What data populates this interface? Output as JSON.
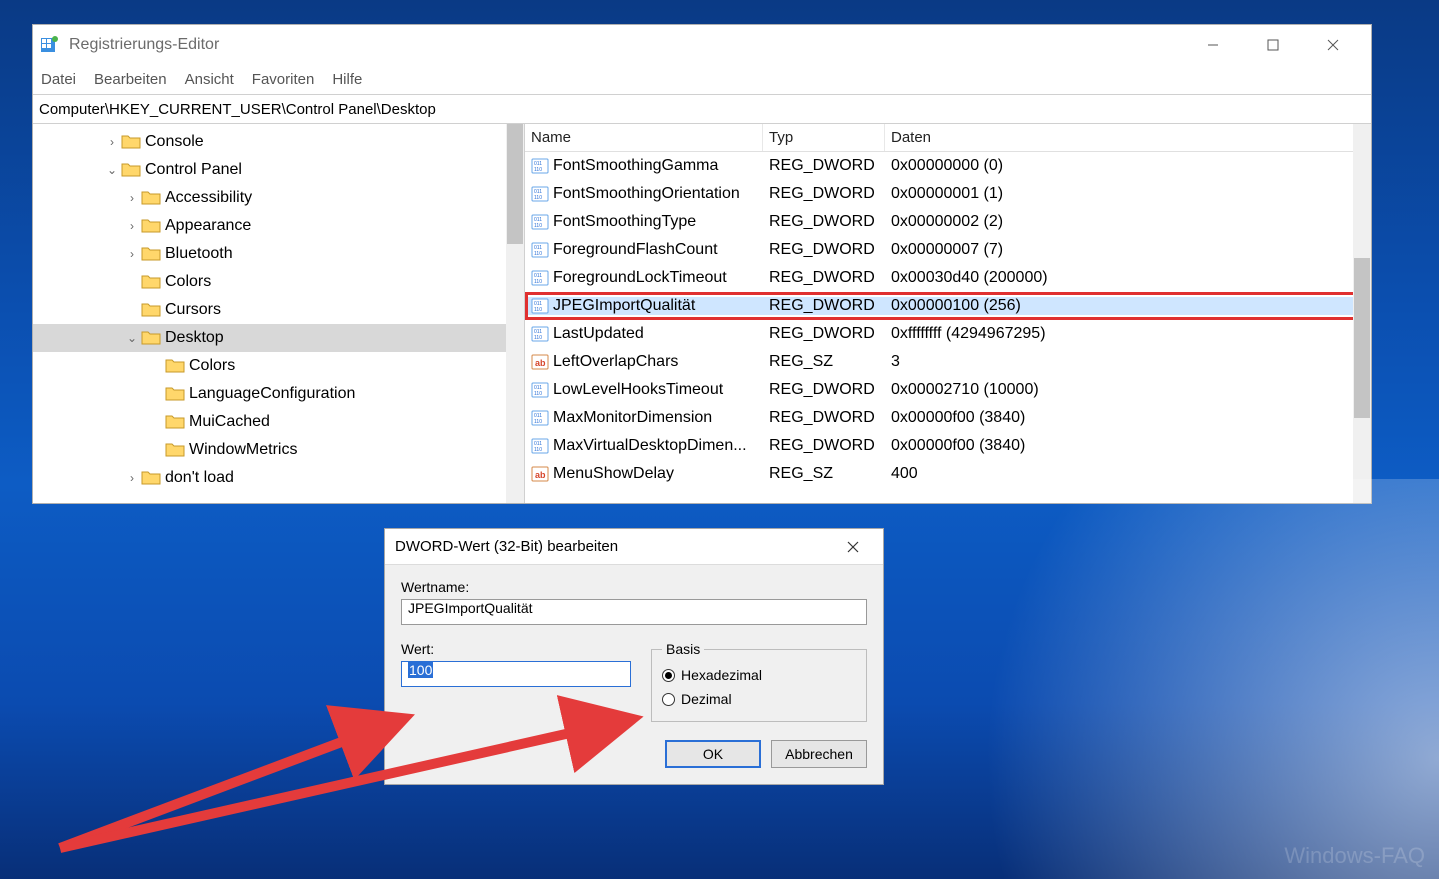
{
  "window": {
    "title": "Registrierungs-Editor",
    "menu": [
      "Datei",
      "Bearbeiten",
      "Ansicht",
      "Favoriten",
      "Hilfe"
    ],
    "address": "Computer\\HKEY_CURRENT_USER\\Control Panel\\Desktop"
  },
  "tree": [
    {
      "level": 1,
      "twisty": ">",
      "label": "Console"
    },
    {
      "level": 1,
      "twisty": "v",
      "label": "Control Panel"
    },
    {
      "level": 2,
      "twisty": ">",
      "label": "Accessibility"
    },
    {
      "level": 2,
      "twisty": ">",
      "label": "Appearance"
    },
    {
      "level": 2,
      "twisty": ">",
      "label": "Bluetooth"
    },
    {
      "level": 2,
      "twisty": "",
      "label": "Colors"
    },
    {
      "level": 2,
      "twisty": "",
      "label": "Cursors"
    },
    {
      "level": 2,
      "twisty": "v",
      "label": "Desktop",
      "selected": true
    },
    {
      "level": 3,
      "twisty": "",
      "label": "Colors"
    },
    {
      "level": 3,
      "twisty": "",
      "label": "LanguageConfiguration"
    },
    {
      "level": 3,
      "twisty": "",
      "label": "MuiCached"
    },
    {
      "level": 3,
      "twisty": "",
      "label": "WindowMetrics"
    },
    {
      "level": 2,
      "twisty": ">",
      "label": "don't load"
    }
  ],
  "columns": {
    "name": "Name",
    "type": "Typ",
    "data": "Daten"
  },
  "values": [
    {
      "icon": "dword",
      "name": "FontSmoothingGamma",
      "type": "REG_DWORD",
      "data": "0x00000000 (0)"
    },
    {
      "icon": "dword",
      "name": "FontSmoothingOrientation",
      "type": "REG_DWORD",
      "data": "0x00000001 (1)"
    },
    {
      "icon": "dword",
      "name": "FontSmoothingType",
      "type": "REG_DWORD",
      "data": "0x00000002 (2)"
    },
    {
      "icon": "dword",
      "name": "ForegroundFlashCount",
      "type": "REG_DWORD",
      "data": "0x00000007 (7)"
    },
    {
      "icon": "dword",
      "name": "ForegroundLockTimeout",
      "type": "REG_DWORD",
      "data": "0x00030d40 (200000)"
    },
    {
      "icon": "dword",
      "name": "JPEGImportQualität",
      "type": "REG_DWORD",
      "data": "0x00000100 (256)",
      "highlight": true
    },
    {
      "icon": "dword",
      "name": "LastUpdated",
      "type": "REG_DWORD",
      "data": "0xffffffff (4294967295)"
    },
    {
      "icon": "sz",
      "name": "LeftOverlapChars",
      "type": "REG_SZ",
      "data": "3"
    },
    {
      "icon": "dword",
      "name": "LowLevelHooksTimeout",
      "type": "REG_DWORD",
      "data": "0x00002710 (10000)"
    },
    {
      "icon": "dword",
      "name": "MaxMonitorDimension",
      "type": "REG_DWORD",
      "data": "0x00000f00 (3840)"
    },
    {
      "icon": "dword",
      "name": "MaxVirtualDesktopDimen...",
      "type": "REG_DWORD",
      "data": "0x00000f00 (3840)"
    },
    {
      "icon": "sz",
      "name": "MenuShowDelay",
      "type": "REG_SZ",
      "data": "400"
    }
  ],
  "dialog": {
    "title": "DWORD-Wert (32-Bit) bearbeiten",
    "name_label": "Wertname:",
    "name_value": "JPEGImportQualität",
    "value_label": "Wert:",
    "value_value": "100",
    "basis_label": "Basis",
    "radio_hex": "Hexadezimal",
    "radio_dec": "Dezimal",
    "ok": "OK",
    "cancel": "Abbrechen"
  },
  "watermark": "Windows-FAQ"
}
